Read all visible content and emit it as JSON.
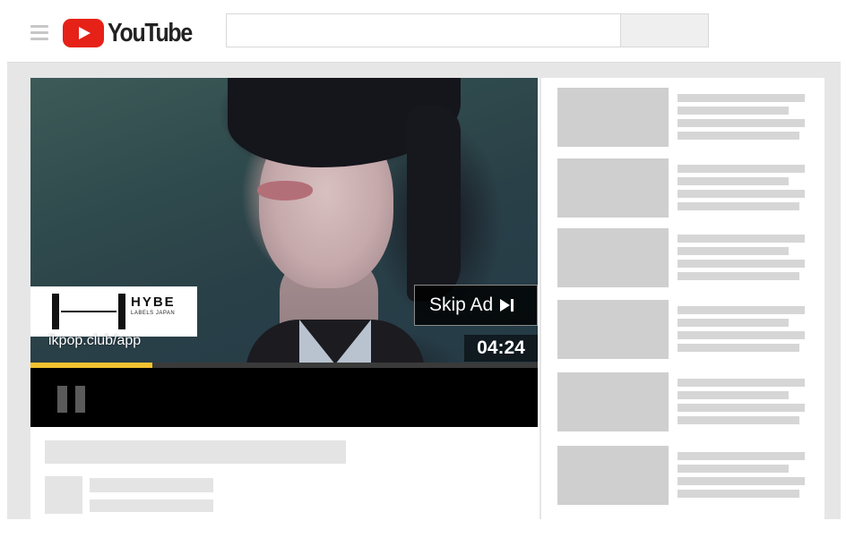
{
  "app": {
    "logo_text": "YouTube"
  },
  "search": {
    "placeholder": "",
    "value": ""
  },
  "ad": {
    "brand": "HYBE",
    "brand_sub": "LABELS JAPAN",
    "url": "ikpop.club/app",
    "skip_label": "Skip Ad",
    "time_remaining": "04:24",
    "progress_fraction": 0.24
  },
  "player": {
    "state": "playing",
    "icons": [
      "pause-icon",
      "skip-next-icon"
    ]
  },
  "colors": {
    "youtube_red": "#e62117",
    "progress": "#f2c230",
    "placeholder": "#d6d6d6"
  },
  "sidebar": {
    "recommendations": [
      {},
      {},
      {},
      {},
      {},
      {}
    ]
  }
}
